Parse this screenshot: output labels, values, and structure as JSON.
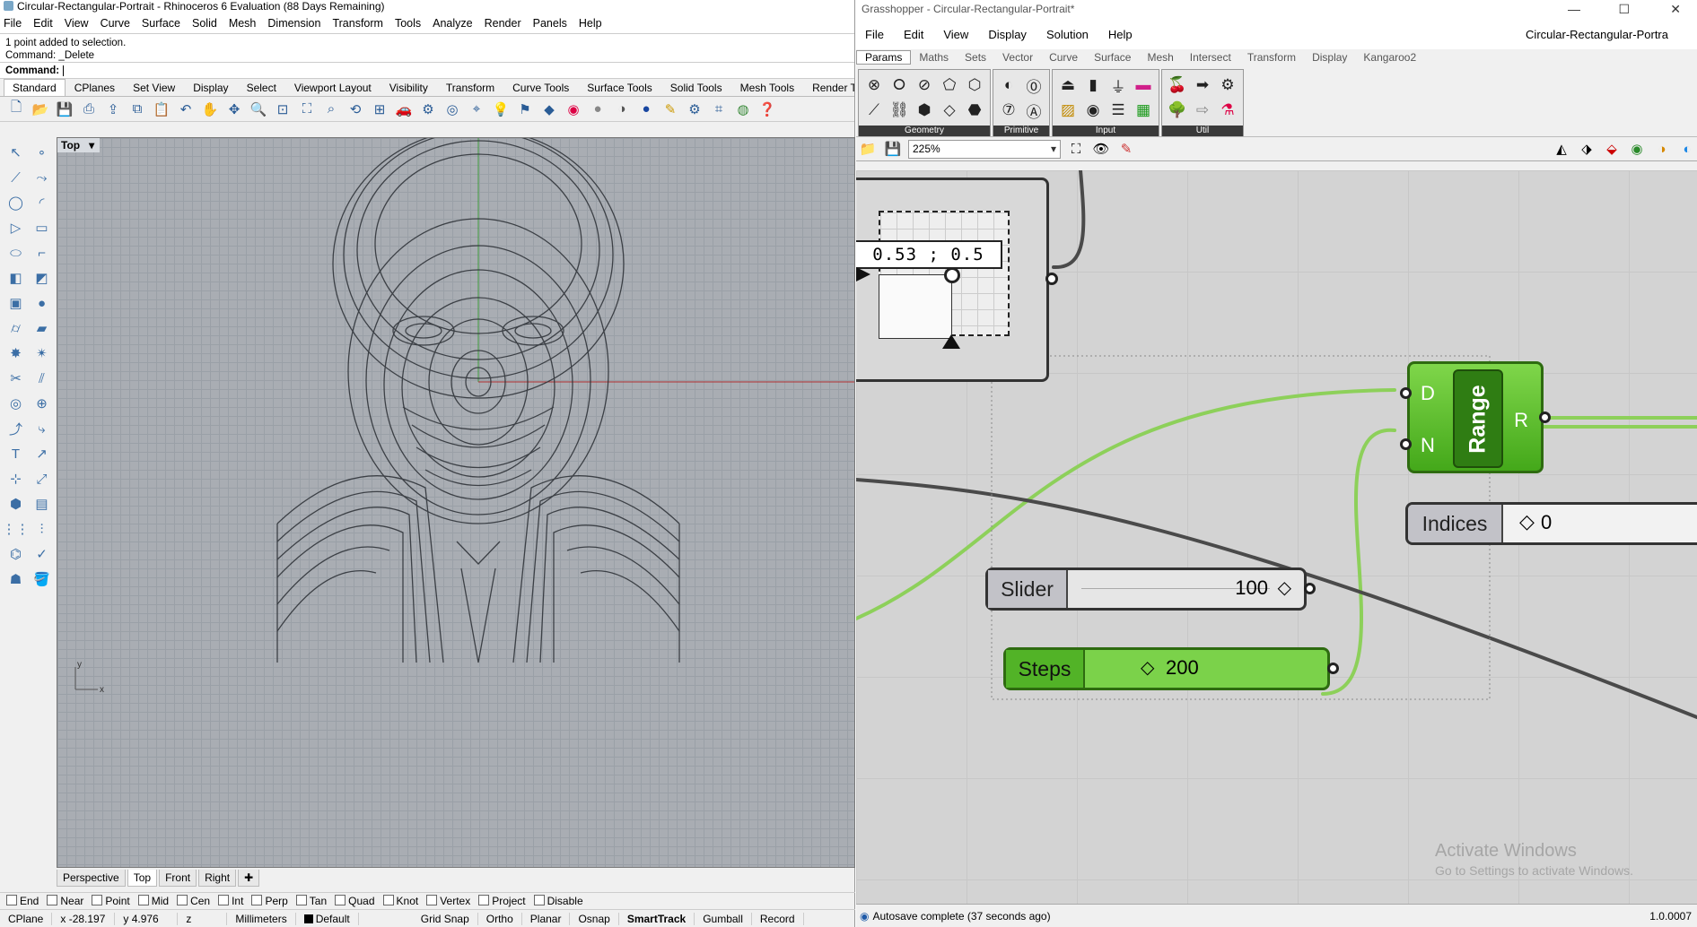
{
  "rhino": {
    "title": "Circular-Rectangular-Portrait - Rhinoceros 6 Evaluation (88 Days Remaining)",
    "menu": [
      "File",
      "Edit",
      "View",
      "Curve",
      "Surface",
      "Solid",
      "Mesh",
      "Dimension",
      "Transform",
      "Tools",
      "Analyze",
      "Render",
      "Panels",
      "Help"
    ],
    "command_history": [
      "1 point added to selection.",
      "Command: _Delete"
    ],
    "command_prompt": "Command:",
    "toolbar_tabs": [
      "Standard",
      "CPlanes",
      "Set View",
      "Display",
      "Select",
      "Viewport Layout",
      "Visibility",
      "Transform",
      "Curve Tools",
      "Surface Tools",
      "Solid Tools",
      "Mesh Tools",
      "Render Tools"
    ],
    "viewport_label": "Top",
    "viewport_tabs": [
      "Perspective",
      "Top",
      "Front",
      "Right"
    ],
    "axis_x": "x",
    "axis_y": "y",
    "osnaps": [
      "End",
      "Near",
      "Point",
      "Mid",
      "Cen",
      "Int",
      "Perp",
      "Tan",
      "Quad",
      "Knot",
      "Vertex",
      "Project",
      "Disable"
    ],
    "status": {
      "cplane": "CPlane",
      "x": "x -28.197",
      "y": "y 4.976",
      "z": "z",
      "units": "Millimeters",
      "layer": "Default",
      "grid_snap": "Grid Snap",
      "ortho": "Ortho",
      "planar": "Planar",
      "osnap": "Osnap",
      "smarttrack": "SmartTrack",
      "gumball": "Gumball",
      "record": "Record"
    }
  },
  "grasshopper": {
    "title": "Grasshopper - Circular-Rectangular-Portrait*",
    "menu": [
      "File",
      "Edit",
      "View",
      "Display",
      "Solution",
      "Help"
    ],
    "document_name": "Circular-Rectangular-Portra",
    "tabs": [
      "Params",
      "Maths",
      "Sets",
      "Vector",
      "Curve",
      "Surface",
      "Mesh",
      "Intersect",
      "Transform",
      "Display",
      "Kangaroo2"
    ],
    "groups": [
      "Geometry",
      "Primitive",
      "Input",
      "Util"
    ],
    "zoom": "225%",
    "nodes": {
      "xy_value": "0.53 ; 0.5",
      "range_label": "Range",
      "range_in_d": "D",
      "range_in_n": "N",
      "range_out": "R",
      "slider_label": "Slider",
      "slider_value": "100",
      "steps_label": "Steps",
      "steps_value": "200",
      "indices_label": "Indices",
      "indices_value": "0"
    },
    "watermark_title": "Activate Windows",
    "watermark_sub": "Go to Settings to activate Windows.",
    "status_text": "Autosave complete (37 seconds ago)",
    "version": "1.0.0007"
  },
  "colors": {
    "gh_green": "#5cbf2a",
    "wire_green": "#8dd05a",
    "wire_dark": "#4a4a4a"
  }
}
